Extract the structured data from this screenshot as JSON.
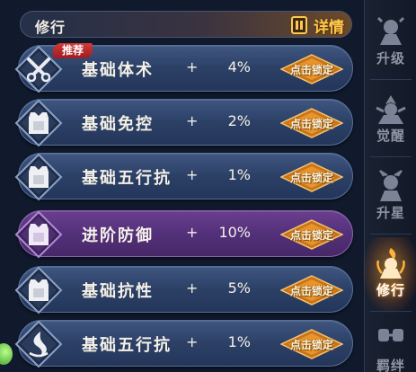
{
  "header": {
    "title": "修行",
    "details_label": "详情"
  },
  "rows": [
    {
      "name": "基础体术",
      "plus": "+",
      "value": "4%",
      "lock_label": "点击锁定",
      "badge": "推荐",
      "icon": "crossed-blades-icon",
      "variant": "blue"
    },
    {
      "name": "基础免控",
      "plus": "+",
      "value": "2%",
      "lock_label": "点击锁定",
      "icon": "armor-vest-icon",
      "variant": "blue"
    },
    {
      "name": "基础五行抗",
      "plus": "+",
      "value": "1%",
      "lock_label": "点击锁定",
      "icon": "armor-vest-icon",
      "variant": "blue"
    },
    {
      "name": "进阶防御",
      "plus": "+",
      "value": "10%",
      "lock_label": "点击锁定",
      "icon": "armor-vest-icon",
      "variant": "purple"
    },
    {
      "name": "基础抗性",
      "plus": "+",
      "value": "5%",
      "lock_label": "点击锁定",
      "icon": "armor-vest-icon",
      "variant": "blue"
    },
    {
      "name": "基础五行抗",
      "plus": "+",
      "value": "1%",
      "lock_label": "点击锁定",
      "icon": "swirl-icon",
      "variant": "blue"
    }
  ],
  "sidebar": {
    "tabs": [
      {
        "label": "升级",
        "icon": "ninja-upgrade-icon"
      },
      {
        "label": "觉醒",
        "icon": "ninja-awaken-icon"
      },
      {
        "label": "升星",
        "icon": "ninja-star-icon"
      },
      {
        "label": "修行",
        "icon": "ninja-training-icon",
        "active": true
      },
      {
        "label": "羁绊",
        "icon": "ninja-bond-icon"
      }
    ]
  },
  "colors": {
    "row_blue": "#2c4066",
    "row_purple": "#53307a",
    "accent_gold": "#ffc94d",
    "lock_orange": "#e9952b"
  }
}
